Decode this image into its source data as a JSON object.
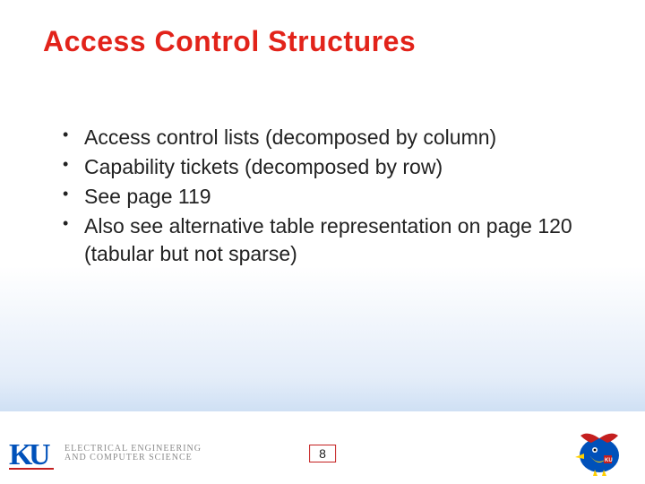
{
  "title": "Access Control Structures",
  "bullets": [
    "Access control lists (decomposed by column)",
    "Capability tickets (decomposed by row)",
    "See page 119",
    "Also see alternative table representation on page 120 (tabular but not sparse)"
  ],
  "footer": {
    "dept_line1": "ELECTRICAL ENGINEERING",
    "dept_line2": "AND COMPUTER SCIENCE",
    "page_number": "8"
  },
  "colors": {
    "title": "#e2231a",
    "page_border": "#c41f1f",
    "ku_blue": "#0051ba"
  }
}
